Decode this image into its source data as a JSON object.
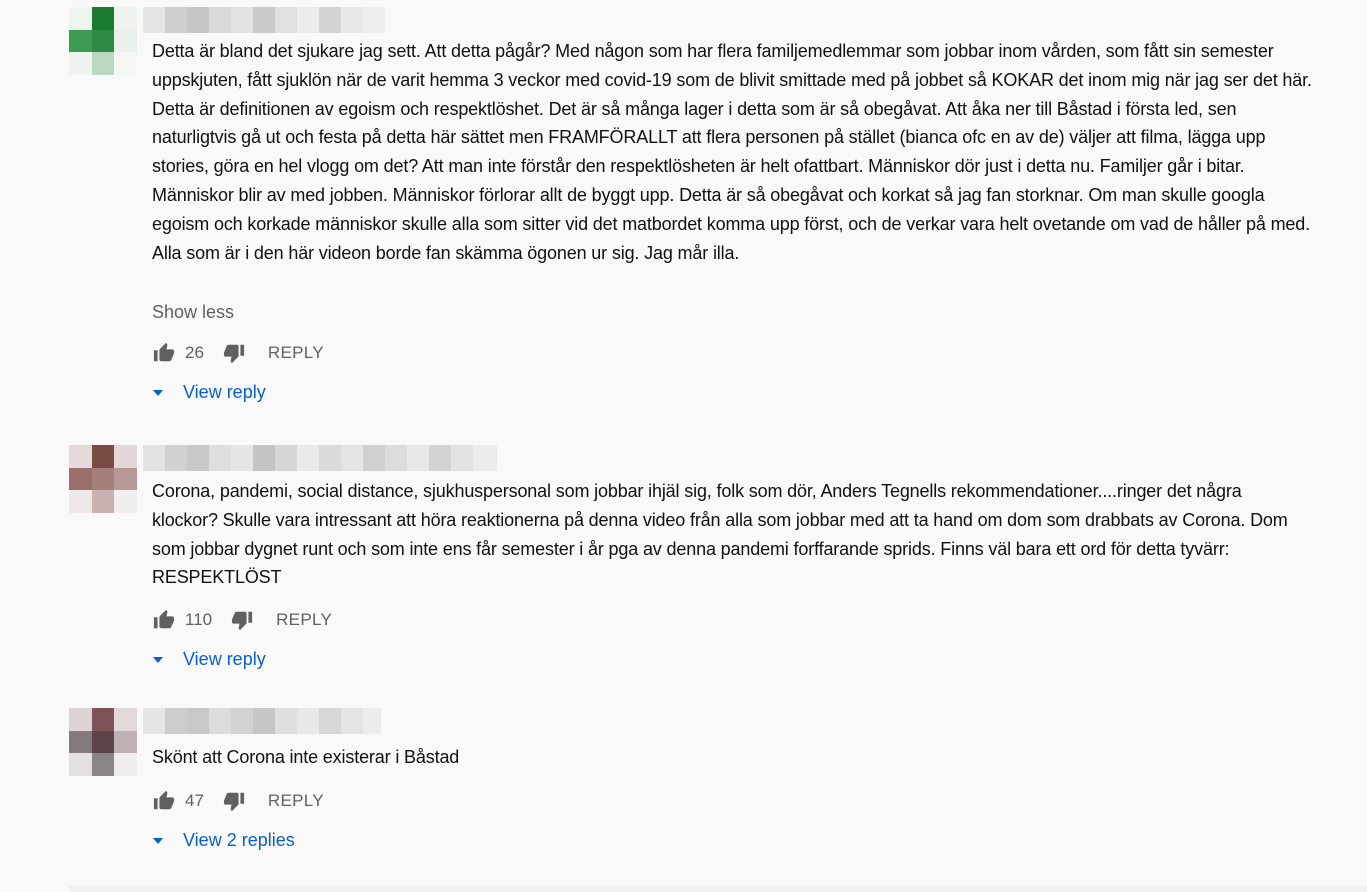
{
  "comments": [
    {
      "text": "Detta är bland det sjukare jag sett. Att detta pågår? Med någon som har flera familjemedlemmar som jobbar inom vården, som fått sin semester uppskjuten, fått sjuklön när de varit hemma 3 veckor med covid-19 som de blivit smittade med på jobbet så KOKAR det inom mig när jag ser det här. Detta är definitionen av egoism och respektlöshet. Det är så många lager i detta som är så obegåvat. Att åka ner till Båstad i första led, sen naturligtvis gå ut och festa på detta här sättet men FRAMFÖRALLT att flera personen på stället (bianca ofc en av de) väljer att filma, lägga upp stories, göra en hel vlogg om det? Att man inte förstår den respektlösheten är helt ofattbart. Människor dör just i detta nu. Familjer går i bitar. Människor blir av med jobben. Människor förlorar allt de byggt upp. Detta är så obegåvat och korkat så jag fan storknar. Om man skulle googla egoism och korkade människor skulle alla som sitter vid det matbordet komma upp först, och de verkar vara helt ovetande om vad de håller på med. Alla som är i den här videon borde fan skämma ögonen ur sig. Jag mår illa.",
      "show_less": "Show less",
      "likes": "26",
      "reply_label": "REPLY",
      "view_replies": "View reply"
    },
    {
      "text": "Corona, pandemi, social distance, sjukhuspersonal som jobbar ihjäl sig, folk som dör, Anders Tegnells rekommendationer....ringer det några klockor? Skulle vara intressant att höra reaktionerna på denna video från alla som jobbar med att ta hand om dom som drabbats av Corona. Dom som jobbar dygnet runt och som inte ens får semester i år pga av denna pandemi forffarande sprids. Finns väl bara ett ord för detta tyvärr: RESPEKTLÖST",
      "likes": "110",
      "reply_label": "REPLY",
      "view_replies": "View reply"
    },
    {
      "text": "Skönt att Corona inte existerar i Båstad",
      "likes": "47",
      "reply_label": "REPLY",
      "view_replies": "View 2 replies"
    }
  ],
  "colors": {
    "link_blue": "#065fd4",
    "secondary_text": "#606060",
    "background": "#f9f9f9"
  },
  "icons": {
    "like": "thumb-up-icon",
    "dislike": "thumb-down-icon",
    "expand": "caret-down-icon",
    "avatar": "pixelated-avatar"
  }
}
